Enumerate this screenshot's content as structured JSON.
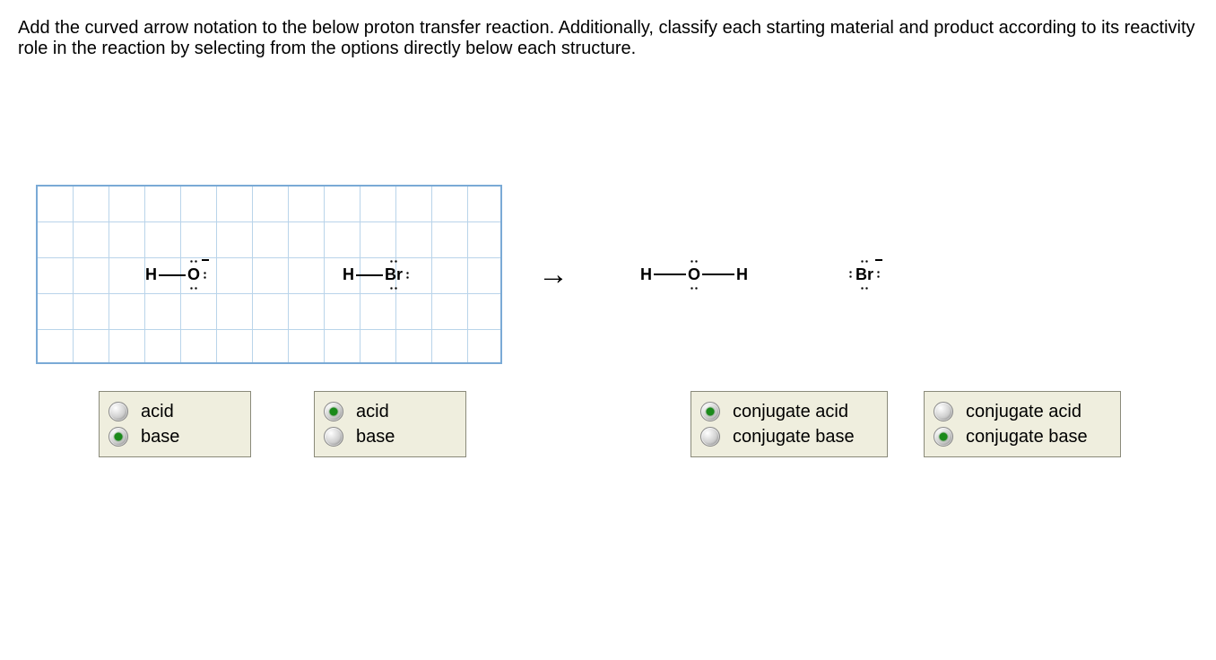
{
  "instructions": "Add the curved arrow notation to the below proton transfer reaction. Additionally, classify each starting material and product according to its reactivity role in the reaction by selecting from the options directly below each structure.",
  "reaction": {
    "reactant1": {
      "left": "H",
      "center": "O",
      "charge": "−",
      "description": "hydroxide with three lone pairs and negative charge"
    },
    "reactant2": {
      "left": "H",
      "center": "Br",
      "description": "H-Br with three lone pairs on Br"
    },
    "arrow": "→",
    "product1": {
      "left": "H",
      "center": "O",
      "right": "H",
      "description": "water with two lone pairs on O"
    },
    "product2": {
      "center": "Br",
      "charge": "−",
      "description": "bromide with four lone pairs and negative charge"
    }
  },
  "groups": [
    {
      "options": [
        {
          "label": "acid",
          "selected": false
        },
        {
          "label": "base",
          "selected": true
        }
      ]
    },
    {
      "options": [
        {
          "label": "acid",
          "selected": true
        },
        {
          "label": "base",
          "selected": false
        }
      ]
    },
    {
      "options": [
        {
          "label": "conjugate acid",
          "selected": true
        },
        {
          "label": "conjugate base",
          "selected": false
        }
      ]
    },
    {
      "options": [
        {
          "label": "conjugate acid",
          "selected": false
        },
        {
          "label": "conjugate base",
          "selected": true
        }
      ]
    }
  ]
}
